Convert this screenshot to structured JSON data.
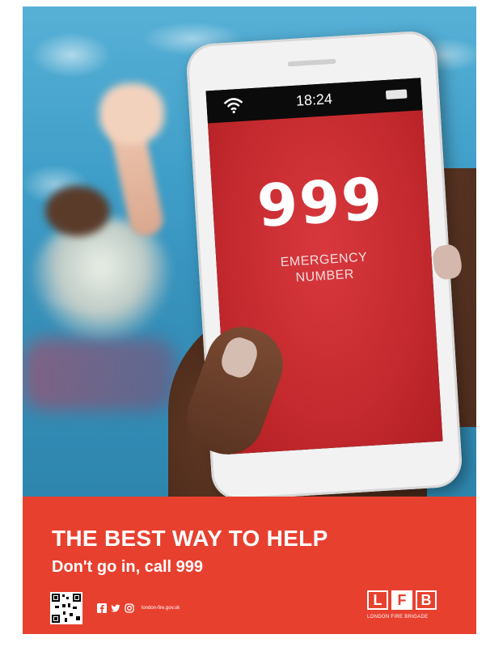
{
  "phone": {
    "time": "18:24",
    "number": "999",
    "label_line1": "EMERGENCY",
    "label_line2": "NUMBER"
  },
  "footer": {
    "headline": "THE BEST WAY TO HELP",
    "subline": "Don't go in, call 999",
    "website": "london-fire.gov.uk",
    "logo_letters": [
      "L",
      "F",
      "B"
    ],
    "logo_caption": "LONDON FIRE BRIGADE"
  },
  "colors": {
    "brand_red": "#e8402f",
    "screen_red": "#c42a2f",
    "pool_blue": "#3f9ec8"
  },
  "icons": [
    "wifi-icon",
    "battery-icon",
    "qr-code",
    "facebook-icon",
    "twitter-icon",
    "instagram-icon"
  ]
}
